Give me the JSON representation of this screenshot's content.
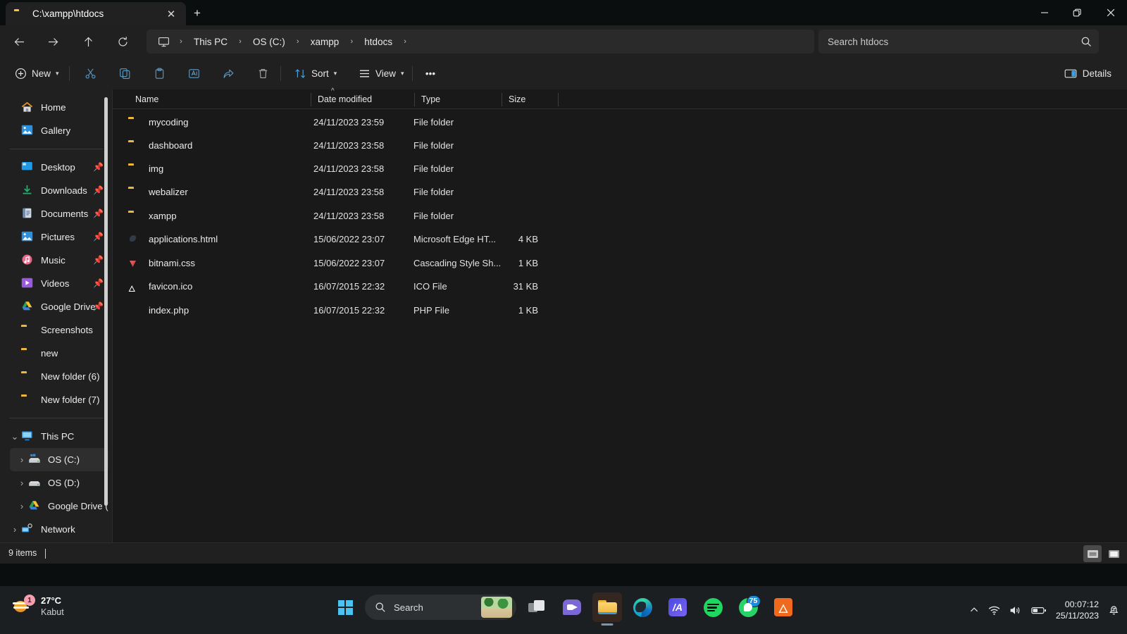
{
  "window": {
    "tab": {
      "title": "C:\\xampp\\htdocs",
      "icon": "folder-icon",
      "close_label": "✕"
    },
    "new_tab_label": "+",
    "controls": {
      "minimize": "minimize-icon",
      "restore": "restore-icon",
      "close": "close-icon"
    }
  },
  "nav": {
    "back": "back-arrow-icon",
    "forward": "forward-arrow-icon",
    "up": "up-arrow-icon",
    "refresh": "refresh-icon",
    "breadcrumb_root_icon": "this-pc-icon",
    "breadcrumbs": [
      "This PC",
      "OS (C:)",
      "xampp",
      "htdocs"
    ],
    "separator": "›"
  },
  "search": {
    "placeholder": "Search htdocs",
    "icon": "search-icon"
  },
  "toolbar": {
    "new_label": "New",
    "cut_label": "cut-icon",
    "copy_label": "copy-icon",
    "paste_label": "paste-icon",
    "rename_label": "rename-icon",
    "share_label": "share-icon",
    "delete_label": "delete-icon",
    "sort_label": "Sort",
    "view_label": "View",
    "more_label": "•••",
    "details_label": "Details"
  },
  "sidebar": {
    "quick": [
      {
        "label": "Home",
        "icon": "home-icon",
        "pinned": false
      },
      {
        "label": "Gallery",
        "icon": "gallery-icon",
        "pinned": false
      }
    ],
    "pinned": [
      {
        "label": "Desktop",
        "icon": "desktop-icon",
        "pinned": true
      },
      {
        "label": "Downloads",
        "icon": "downloads-icon",
        "pinned": true
      },
      {
        "label": "Documents",
        "icon": "documents-icon",
        "pinned": true
      },
      {
        "label": "Pictures",
        "icon": "pictures-icon",
        "pinned": true
      },
      {
        "label": "Music",
        "icon": "music-icon",
        "pinned": true
      },
      {
        "label": "Videos",
        "icon": "videos-icon",
        "pinned": true
      },
      {
        "label": "Google Drive",
        "icon": "google-drive-icon",
        "pinned": true
      },
      {
        "label": "Screenshots",
        "icon": "folder-icon",
        "pinned": false
      },
      {
        "label": "new",
        "icon": "folder-icon",
        "pinned": false
      },
      {
        "label": "New folder (6)",
        "icon": "folder-icon",
        "pinned": false
      },
      {
        "label": "New folder (7)",
        "icon": "folder-icon",
        "pinned": false
      }
    ],
    "tree": [
      {
        "label": "This PC",
        "icon": "this-pc-icon",
        "chevron": "⌄",
        "expanded": true,
        "selected": false,
        "indent": 0
      },
      {
        "label": "OS (C:)",
        "icon": "drive-windows-icon",
        "chevron": "›",
        "expanded": false,
        "selected": true,
        "indent": 1
      },
      {
        "label": "OS (D:)",
        "icon": "drive-icon",
        "chevron": "›",
        "expanded": false,
        "selected": false,
        "indent": 1
      },
      {
        "label": "Google Drive (",
        "icon": "google-drive-icon",
        "chevron": "›",
        "expanded": false,
        "selected": false,
        "indent": 1
      },
      {
        "label": "Network",
        "icon": "network-icon",
        "chevron": "›",
        "expanded": false,
        "selected": false,
        "indent": 0
      }
    ]
  },
  "filelist": {
    "columns": [
      "Name",
      "Date modified",
      "Type",
      "Size"
    ],
    "sort_column": "Name",
    "sort_direction": "ascending",
    "rows": [
      {
        "name": "mycoding",
        "date": "24/11/2023 23:59",
        "type": "File folder",
        "size": "",
        "icon": "folder-icon"
      },
      {
        "name": "dashboard",
        "date": "24/11/2023 23:58",
        "type": "File folder",
        "size": "",
        "icon": "folder-icon"
      },
      {
        "name": "img",
        "date": "24/11/2023 23:58",
        "type": "File folder",
        "size": "",
        "icon": "folder-icon"
      },
      {
        "name": "webalizer",
        "date": "24/11/2023 23:58",
        "type": "File folder",
        "size": "",
        "icon": "folder-icon"
      },
      {
        "name": "xampp",
        "date": "24/11/2023 23:58",
        "type": "File folder",
        "size": "",
        "icon": "folder-icon"
      },
      {
        "name": "applications.html",
        "date": "15/06/2022 23:07",
        "type": "Microsoft Edge HT...",
        "size": "4 KB",
        "icon": "edge-html-icon"
      },
      {
        "name": "bitnami.css",
        "date": "15/06/2022 23:07",
        "type": "Cascading Style Sh...",
        "size": "1 KB",
        "icon": "css-file-icon"
      },
      {
        "name": "favicon.ico",
        "date": "16/07/2015 22:32",
        "type": "ICO File",
        "size": "31 KB",
        "icon": "ico-file-icon"
      },
      {
        "name": "index.php",
        "date": "16/07/2015 22:32",
        "type": "PHP File",
        "size": "1 KB",
        "icon": "php-file-icon"
      }
    ]
  },
  "statusbar": {
    "item_count": "9 items",
    "view_details_icon": "details-view-icon",
    "view_large_icon": "large-icons-view-icon"
  },
  "taskbar": {
    "weather": {
      "temperature": "27°C",
      "condition": "Kabut",
      "badge": "1",
      "icon": "fog-icon"
    },
    "start": "windows-start-icon",
    "search": {
      "label": "Search",
      "icon": "search-icon",
      "thumbnail": "landscape-thumbnail"
    },
    "apps": [
      {
        "name": "task-view",
        "label": "Task View",
        "icon": "task-view-icon",
        "active": false,
        "badge": ""
      },
      {
        "name": "chat",
        "label": "Chat",
        "icon": "chat-icon",
        "active": false,
        "badge": ""
      },
      {
        "name": "file-explorer",
        "label": "File Explorer",
        "icon": "file-explorer-icon",
        "active": true,
        "badge": ""
      },
      {
        "name": "edge",
        "label": "Microsoft Edge",
        "icon": "edge-icon",
        "active": false,
        "badge": ""
      },
      {
        "name": "blue-app",
        "label": "App",
        "icon": "blue-app-icon",
        "active": false,
        "badge": ""
      },
      {
        "name": "spotify",
        "label": "Spotify",
        "icon": "spotify-icon",
        "active": false,
        "badge": ""
      },
      {
        "name": "whatsapp",
        "label": "WhatsApp",
        "icon": "whatsapp-icon",
        "active": false,
        "badge": "75"
      },
      {
        "name": "xampp",
        "label": "XAMPP",
        "icon": "xampp-icon",
        "active": false,
        "badge": ""
      }
    ],
    "tray": {
      "overflow": "chevron-up-icon",
      "wifi": "wifi-icon",
      "volume": "volume-icon",
      "battery": "battery-icon",
      "time": "00:07:12",
      "date": "25/11/2023",
      "notifications": "notifications-muted-icon"
    }
  },
  "colors": {
    "accent": "#4cc2f1",
    "window_bg": "#202020",
    "list_bg": "#191919",
    "folder_yellow": "#efb63a"
  }
}
